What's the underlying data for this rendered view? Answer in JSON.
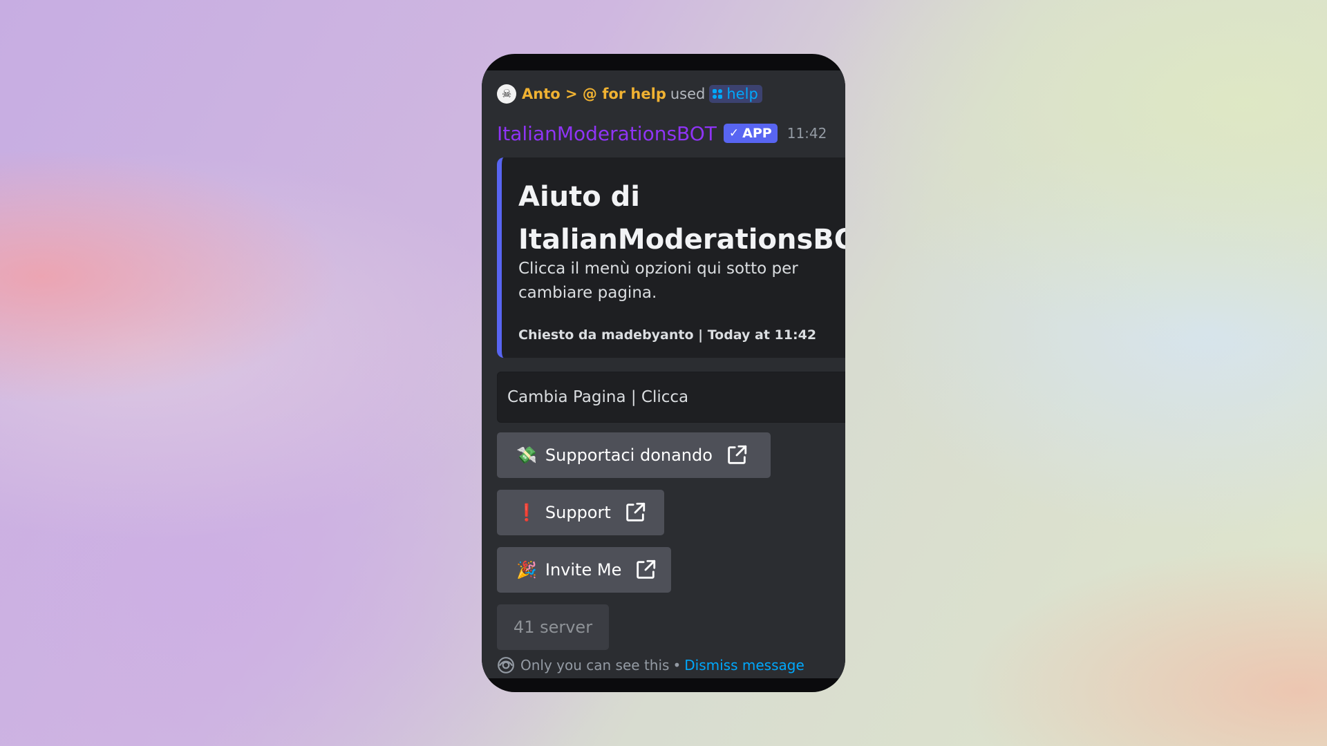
{
  "reply": {
    "user": "Anto > @ for help",
    "action": "used",
    "command": "help",
    "avatar_icon": "skull-avatar-icon"
  },
  "message": {
    "author": "ItalianModerationsBOT",
    "badge": "APP",
    "time": "11:42"
  },
  "embed": {
    "title": "Aiuto di\nItalianModerationsBOT",
    "description": "Clicca il menù opzioni qui sotto per cambiare pagina.",
    "footer": "Chiesto da madebyanto | Today at 11:42",
    "accent_color": "#5865f2"
  },
  "select_menu": {
    "placeholder": "Cambia Pagina | Clicca"
  },
  "buttons": [
    {
      "emoji": "💸",
      "label": "Supportaci donando",
      "icon": "external-link-icon"
    },
    {
      "emoji": "❗",
      "label": "Support",
      "icon": "external-link-icon"
    },
    {
      "emoji": "🎉",
      "label": "Invite Me",
      "icon": "external-link-icon"
    }
  ],
  "server_count": "41 server",
  "ephemeral": {
    "notice": "Only you can see this",
    "separator": "•",
    "dismiss": "Dismiss message"
  },
  "colors": {
    "background": "#2b2d31",
    "author": "#8f34f6",
    "reply_user": "#f0b232",
    "link": "#00a8fc",
    "button": "#4e5058"
  }
}
